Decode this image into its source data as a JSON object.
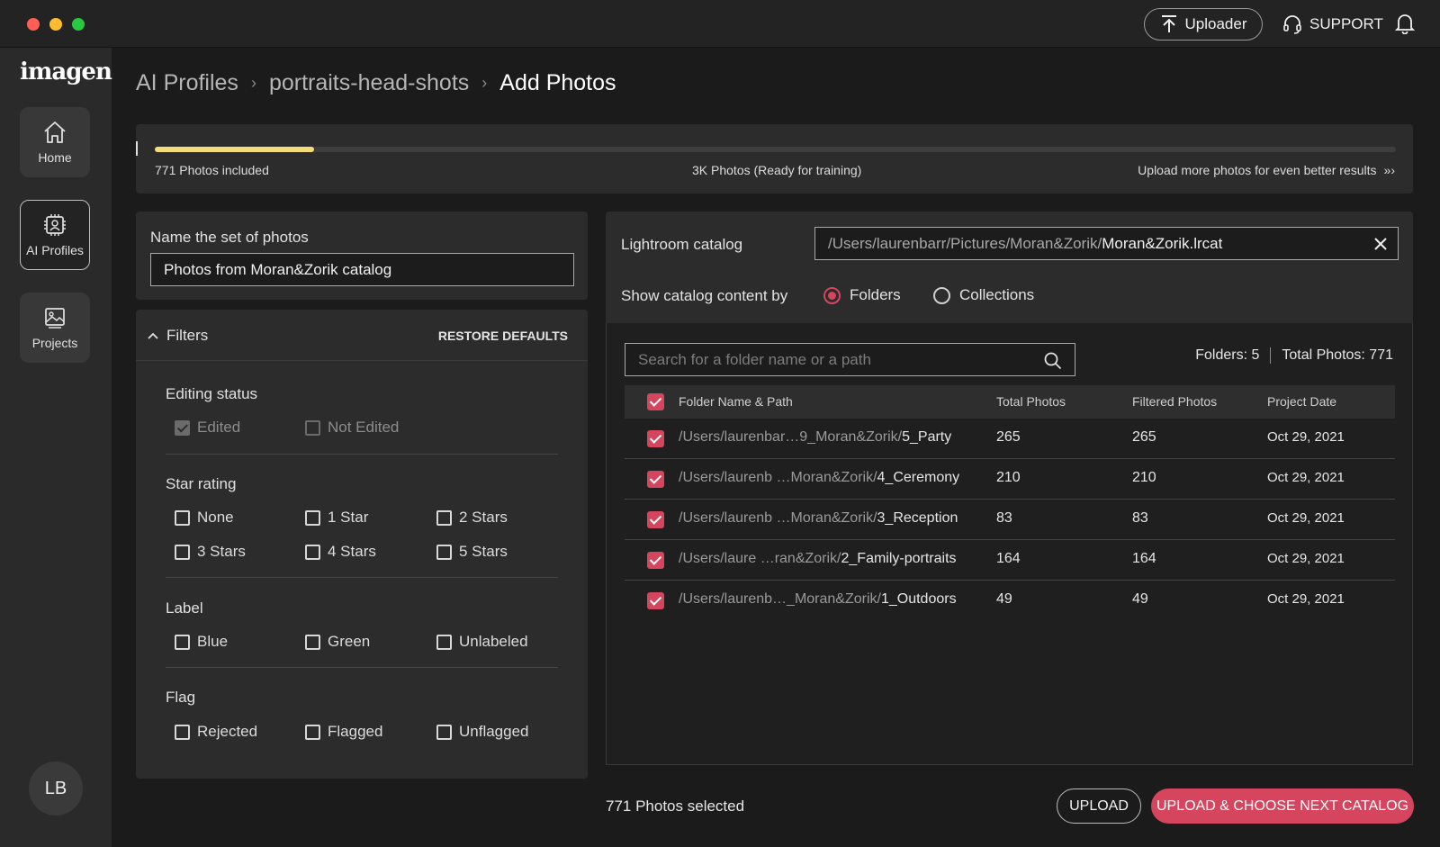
{
  "header": {
    "uploader_label": "Uploader",
    "support_label": "SUPPORT"
  },
  "sidebar": {
    "logo": "imagen",
    "items": [
      {
        "label": "Home",
        "icon": "home-icon"
      },
      {
        "label": "AI Profiles",
        "icon": "ai-profile-icon"
      },
      {
        "label": "Projects",
        "icon": "projects-icon"
      }
    ],
    "avatar_initials": "LB"
  },
  "breadcrumb": {
    "items": [
      "AI Profiles",
      "portraits-head-shots"
    ],
    "current": "Add Photos"
  },
  "progress": {
    "included_fraction": 0.128,
    "milestone_fraShown": 0.5,
    "included_label": "771 Photos included",
    "milestone_label": "3K Photos (Ready for training)",
    "more_label": "Upload more photos for even better results",
    "more_icon": "»›",
    "accent_color": "#f2dd7a"
  },
  "set_name": {
    "label": "Name the set of photos",
    "value": "Photos from Moran&Zorik catalog"
  },
  "filters": {
    "title": "Filters",
    "restore_label": "RESTORE DEFAULTS",
    "editing": {
      "title": "Editing status",
      "options": [
        "Edited",
        "Not Edited"
      ]
    },
    "star": {
      "title": "Star rating",
      "options": [
        "None",
        "1 Star",
        "2 Stars",
        "3 Stars",
        "4 Stars",
        "5 Stars"
      ]
    },
    "label": {
      "title": "Label",
      "options": [
        "Blue",
        "Green",
        "Unlabeled"
      ]
    },
    "flag": {
      "title": "Flag",
      "options": [
        "Rejected",
        "Flagged",
        "Unflagged"
      ]
    }
  },
  "catalog": {
    "label": "Lightroom catalog",
    "path_prefix": "/Users/laurenbarr/Pictures/Moran&Zorik/",
    "path_file": "Moran&Zorik.lrcat",
    "show_by_label": "Show catalog content by",
    "options": [
      "Folders",
      "Collections"
    ],
    "selected": "Folders"
  },
  "search": {
    "placeholder": "Search for a folder name or a path"
  },
  "stats": {
    "folders": "Folders: 5",
    "total_photos": "Total Photos: 771"
  },
  "table": {
    "columns": [
      "Folder Name & Path",
      "Total Photos",
      "Filtered Photos",
      "Project Date"
    ],
    "rows": [
      {
        "path_dim": "/Users/laurenbar…",
        "path_mid": "9_Moran&Zorik/",
        "name": "5_Party",
        "total": "265",
        "filtered": "265",
        "date": "Oct 29, 2021"
      },
      {
        "path_dim": "/Users/laurenb …",
        "path_mid": "Moran&Zorik/",
        "name": "4_Ceremony",
        "total": "210",
        "filtered": "210",
        "date": "Oct 29, 2021"
      },
      {
        "path_dim": "/Users/laurenb …",
        "path_mid": "Moran&Zorik/",
        "name": "3_Reception",
        "total": "83",
        "filtered": "83",
        "date": "Oct 29, 2021"
      },
      {
        "path_dim": "/Users/laure …",
        "path_mid": "ran&Zorik/",
        "name": "2_Family-portraits",
        "total": "164",
        "filtered": "164",
        "date": "Oct 29, 2021"
      },
      {
        "path_dim": "/Users/laurenb…",
        "path_mid": "_Moran&Zorik/",
        "name": "1_Outdoors",
        "total": "49",
        "filtered": "49",
        "date": "Oct 29, 2021"
      }
    ]
  },
  "footer": {
    "selected_label": "771 Photos selected",
    "upload_label": "UPLOAD",
    "upload_next_label": "UPLOAD & CHOOSE NEXT CATALOG"
  },
  "colors": {
    "accent": "#d5455d",
    "background": "#1b1b1b",
    "panel": "#2c2c2c"
  }
}
